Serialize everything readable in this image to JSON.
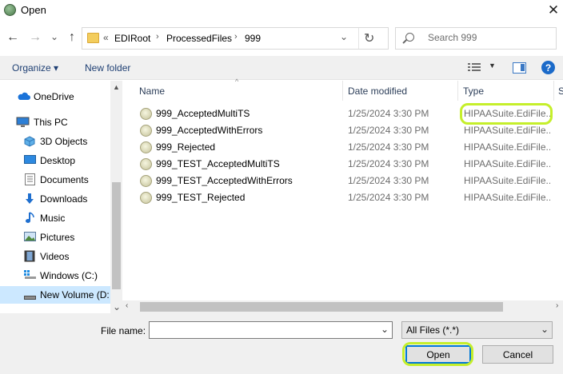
{
  "window": {
    "title": "Open",
    "close_glyph": "✕",
    "icon": "app-icon"
  },
  "nav": {
    "back_glyph": "←",
    "forward_glyph": "→",
    "recent_glyph": "⌄",
    "up_glyph": "↑"
  },
  "address": {
    "overflow": "«",
    "crumbs": [
      "EDIRoot",
      "ProcessedFiles",
      "999"
    ],
    "separator": "›",
    "dropdown_glyph": "⌄",
    "refresh_glyph": "↻"
  },
  "search": {
    "placeholder": "Search 999"
  },
  "toolbar": {
    "organize": "Organize ▾",
    "new_folder": "New folder",
    "view_drop": "▼",
    "help": "?"
  },
  "sidebar": {
    "items": [
      {
        "label": "OneDrive",
        "icon": "cloud-icon"
      },
      {
        "label": "This PC",
        "icon": "computer-icon"
      },
      {
        "label": "3D Objects",
        "icon": "cube-icon"
      },
      {
        "label": "Desktop",
        "icon": "desktop-icon"
      },
      {
        "label": "Documents",
        "icon": "documents-icon"
      },
      {
        "label": "Downloads",
        "icon": "download-arrow-icon"
      },
      {
        "label": "Music",
        "icon": "music-note-icon"
      },
      {
        "label": "Pictures",
        "icon": "pictures-icon"
      },
      {
        "label": "Videos",
        "icon": "film-icon"
      },
      {
        "label": "Windows (C:)",
        "icon": "drive-icon"
      },
      {
        "label": "New Volume (D:",
        "icon": "drive-icon",
        "selected": true
      }
    ],
    "scroll_up": "▲",
    "scroll_down": "⌄"
  },
  "list": {
    "columns": [
      "Name",
      "Date modified",
      "Type",
      "S"
    ],
    "sort_glyph": "^",
    "files": [
      {
        "name": "999_AcceptedMultiTS",
        "date": "1/25/2024 3:30 PM",
        "type": "HIPAASuite.EdiFile..."
      },
      {
        "name": "999_AcceptedWithErrors",
        "date": "1/25/2024 3:30 PM",
        "type": "HIPAASuite.EdiFile..."
      },
      {
        "name": "999_Rejected",
        "date": "1/25/2024 3:30 PM",
        "type": "HIPAASuite.EdiFile..."
      },
      {
        "name": "999_TEST_AcceptedMultiTS",
        "date": "1/25/2024 3:30 PM",
        "type": "HIPAASuite.EdiFile..."
      },
      {
        "name": "999_TEST_AcceptedWithErrors",
        "date": "1/25/2024 3:30 PM",
        "type": "HIPAASuite.EdiFile..."
      },
      {
        "name": "999_TEST_Rejected",
        "date": "1/25/2024 3:30 PM",
        "type": "HIPAASuite.EdiFile..."
      }
    ],
    "h_left": "‹",
    "h_right": "›"
  },
  "footer": {
    "file_name_label": "File name:",
    "file_name_value": "",
    "file_name_drop": "⌄",
    "filter": "All Files (*.*)",
    "filter_drop": "⌄",
    "open": "Open",
    "cancel": "Cancel"
  },
  "colors": {
    "highlight": "#c5ef2b",
    "accent": "#0078d7",
    "selection": "#cce8ff"
  }
}
